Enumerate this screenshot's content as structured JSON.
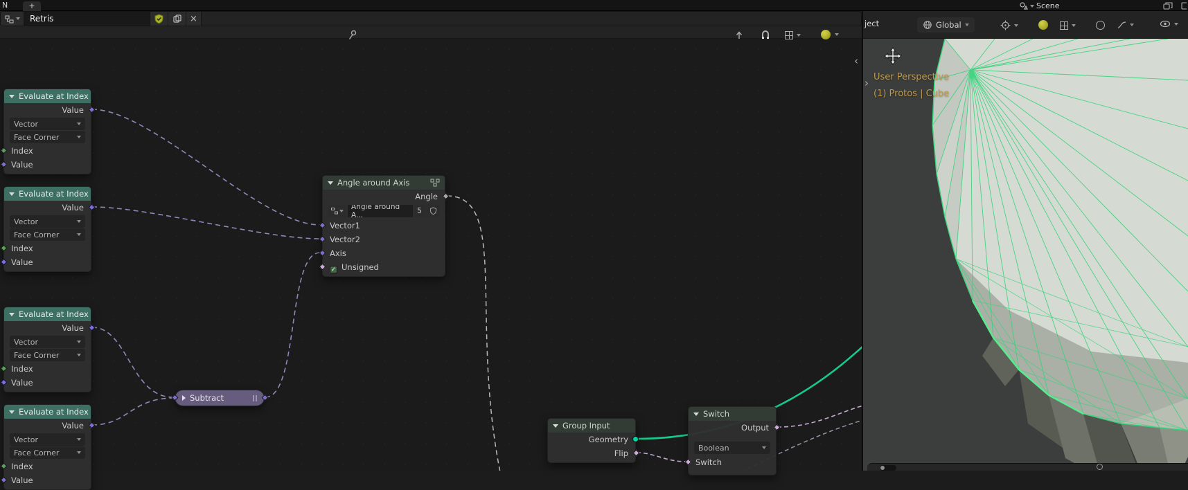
{
  "colors": {
    "canvas_bg": "#1b1b1b",
    "header_bg": "#232323",
    "topbar_bg": "#141414",
    "node_body": "#2f2f2f",
    "evaluate_header": "#3e6f63",
    "dark_node_header": "#323c34",
    "subtract_pill": "#665d7e",
    "vector_socket": "#7a6fd4",
    "integer_socket": "#5c9e5c",
    "boolean_socket": "#cfa9da",
    "float_socket": "#a8a8a8",
    "geometry_socket": "#00d6a3",
    "geometry_link": "#17c98a",
    "field_link": "#8f88b8",
    "viewport_bg": "#3c3e3d",
    "mesh_surface": "#d5dad2",
    "wireframe_green": "#34d379",
    "overlay_text": "#bd9b51",
    "active_toggle_yellow": "#b2b22f"
  },
  "topbar": {
    "partial_text": "N",
    "new_tab_label": "+",
    "scene_label": "Scene"
  },
  "node_editor": {
    "header": {
      "tree_name": "Retris"
    },
    "evaluate_node": {
      "title": "Evaluate at Index",
      "output": "Value",
      "type": "Vector",
      "domain": "Face Corner",
      "input_index": "Index",
      "input_value": "Value"
    },
    "angle_node": {
      "title": "Angle around Axis",
      "output": "Angle",
      "datablock_name": "Angle around A...",
      "users": "5",
      "input1": "Vector1",
      "input2": "Vector2",
      "input3": "Axis",
      "checkbox": "Unsigned"
    },
    "subtract_node": {
      "title": "Subtract"
    },
    "group_input_node": {
      "title": "Group Input",
      "output_geometry": "Geometry",
      "output_flip": "Flip"
    },
    "switch_node": {
      "title": "Switch",
      "output": "Output",
      "type": "Boolean",
      "input": "Switch"
    }
  },
  "viewport": {
    "mode_partial": "ject",
    "orientation": "Global",
    "overlay_line1": "User Perspective",
    "overlay_line2": "(1) Protos | Cube"
  }
}
